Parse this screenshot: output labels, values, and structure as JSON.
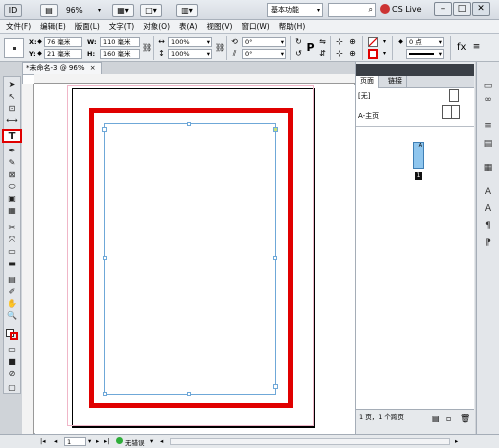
{
  "titlebar": {
    "app_icon": "ID",
    "zoom": "96%",
    "workspace": "基本功能",
    "cs_live": "CS Live",
    "minimize": "–",
    "restore": "□",
    "close": "✕"
  },
  "menubar": {
    "items": [
      "文件(F)",
      "编辑(E)",
      "版面(L)",
      "文字(T)",
      "对象(O)",
      "表(A)",
      "视图(V)",
      "窗口(W)",
      "帮助(H)"
    ]
  },
  "control": {
    "x_label": "X:",
    "x_value": "76 毫米",
    "y_label": "Y:",
    "y_value": "21 毫米",
    "w_label": "W:",
    "w_value": "110 毫米",
    "h_label": "H:",
    "h_value": "160 毫米",
    "scale_x": "100%",
    "scale_y": "100%",
    "rotate": "0°",
    "shear": "0°",
    "stroke_weight": "0 点"
  },
  "document": {
    "tab_label": "*未命名-3 @ 96%",
    "tab_close": "×"
  },
  "panels": {
    "tab_pages": "页面",
    "tab_links": "链接",
    "none_master": "[无]",
    "a_master": "A-主页",
    "page_number": "1",
    "status": "1 页，1 个跨页"
  },
  "statusbar": {
    "page": "1",
    "errors": "无错误"
  },
  "colors": {
    "highlight": "#e00000",
    "frame": "#6fa8d8",
    "page_thumb": "#8fc6ee"
  }
}
